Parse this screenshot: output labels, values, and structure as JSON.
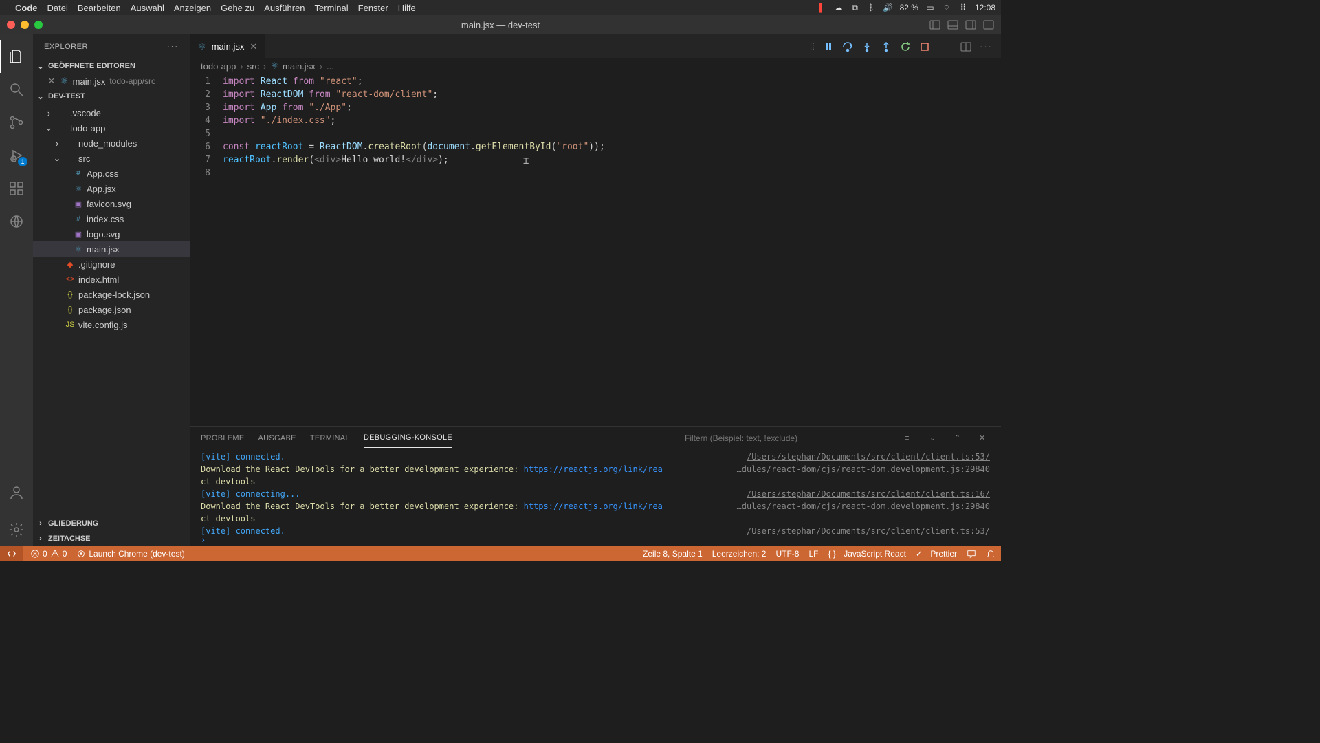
{
  "menubar": {
    "app": "Code",
    "items": [
      "Datei",
      "Bearbeiten",
      "Auswahl",
      "Anzeigen",
      "Gehe zu",
      "Ausführen",
      "Terminal",
      "Fenster",
      "Hilfe"
    ],
    "battery": "82 %",
    "time": "12:08"
  },
  "window": {
    "title": "main.jsx — dev-test"
  },
  "sidebar": {
    "title": "EXPLORER",
    "openEditors": "GEÖFFNETE EDITOREN",
    "openTab": {
      "name": "main.jsx",
      "dir": "todo-app/src"
    },
    "workspace": "DEV-TEST",
    "tree": [
      {
        "name": ".vscode",
        "type": "folder",
        "depth": 0,
        "open": false
      },
      {
        "name": "todo-app",
        "type": "folder",
        "depth": 0,
        "open": true
      },
      {
        "name": "node_modules",
        "type": "folder",
        "depth": 1,
        "open": false
      },
      {
        "name": "src",
        "type": "folder",
        "depth": 1,
        "open": true
      },
      {
        "name": "App.css",
        "type": "css",
        "depth": 2
      },
      {
        "name": "App.jsx",
        "type": "jsx",
        "depth": 2
      },
      {
        "name": "favicon.svg",
        "type": "svg",
        "depth": 2
      },
      {
        "name": "index.css",
        "type": "css",
        "depth": 2
      },
      {
        "name": "logo.svg",
        "type": "svg",
        "depth": 2
      },
      {
        "name": "main.jsx",
        "type": "jsx",
        "depth": 2,
        "selected": true
      },
      {
        "name": ".gitignore",
        "type": "git",
        "depth": 1
      },
      {
        "name": "index.html",
        "type": "html",
        "depth": 1
      },
      {
        "name": "package-lock.json",
        "type": "json",
        "depth": 1
      },
      {
        "name": "package.json",
        "type": "json",
        "depth": 1
      },
      {
        "name": "vite.config.js",
        "type": "js",
        "depth": 1
      }
    ],
    "outline": "GLIEDERUNG",
    "timeline": "ZEITACHSE"
  },
  "activity": {
    "debugBadge": "1"
  },
  "editor": {
    "tab": "main.jsx",
    "breadcrumbs": [
      "todo-app",
      "src",
      "main.jsx",
      "..."
    ],
    "lines": 8
  },
  "code": {
    "l1": {
      "import": "import",
      "React": "React",
      "from": "from",
      "str": "\"react\""
    },
    "l2": {
      "import": "import",
      "ReactDOM": "ReactDOM",
      "from": "from",
      "str": "\"react-dom/client\""
    },
    "l3": {
      "import": "import",
      "App": "App",
      "from": "from",
      "str": "\"./App\""
    },
    "l4": {
      "import": "import",
      "str": "\"./index.css\""
    },
    "l6": {
      "const": "const",
      "reactRoot": "reactRoot",
      "ReactDOM": "ReactDOM",
      "createRoot": "createRoot",
      "document": "document",
      "getElementById": "getElementById",
      "root": "\"root\""
    },
    "l7": {
      "reactRoot": "reactRoot",
      "render": "render",
      "div1": "<div>",
      "hello": "Hello world!",
      "div2": "</div>"
    }
  },
  "panel": {
    "tabs": {
      "problems": "PROBLEME",
      "output": "AUSGABE",
      "terminal": "TERMINAL",
      "debug": "DEBUGGING-KONSOLE"
    },
    "filterPlaceholder": "Filtern (Beispiel: text, !exclude)",
    "lines": [
      {
        "msg_parts": [
          {
            "c": "vite",
            "t": "[vite] connected."
          }
        ],
        "src": "/Users/stephan/Documents/src/client/client.ts:53/"
      },
      {
        "msg_parts": [
          {
            "c": "warn",
            "t": "Download the React DevTools for a better development experience: "
          },
          {
            "c": "link",
            "t": "https://reactjs.org/link/rea"
          }
        ],
        "src": "…dules/react-dom/cjs/react-dom.development.js:29840"
      },
      {
        "msg_parts": [
          {
            "c": "warn",
            "t": "ct-devtools"
          }
        ],
        "src": ""
      },
      {
        "msg_parts": [
          {
            "c": "vite",
            "t": "[vite] connecting..."
          }
        ],
        "src": "/Users/stephan/Documents/src/client/client.ts:16/"
      },
      {
        "msg_parts": [
          {
            "c": "warn",
            "t": "Download the React DevTools for a better development experience: "
          },
          {
            "c": "link",
            "t": "https://reactjs.org/link/rea"
          }
        ],
        "src": "…dules/react-dom/cjs/react-dom.development.js:29840"
      },
      {
        "msg_parts": [
          {
            "c": "warn",
            "t": "ct-devtools"
          }
        ],
        "src": ""
      },
      {
        "msg_parts": [
          {
            "c": "vite",
            "t": "[vite] connected."
          }
        ],
        "src": "/Users/stephan/Documents/src/client/client.ts:53/"
      }
    ]
  },
  "status": {
    "errors": "0",
    "warnings": "0",
    "launch": "Launch Chrome (dev-test)",
    "line": "Zeile 8, Spalte 1",
    "spaces": "Leerzeichen: 2",
    "encoding": "UTF-8",
    "eol": "LF",
    "lang": "JavaScript React",
    "prettier": "Prettier"
  }
}
